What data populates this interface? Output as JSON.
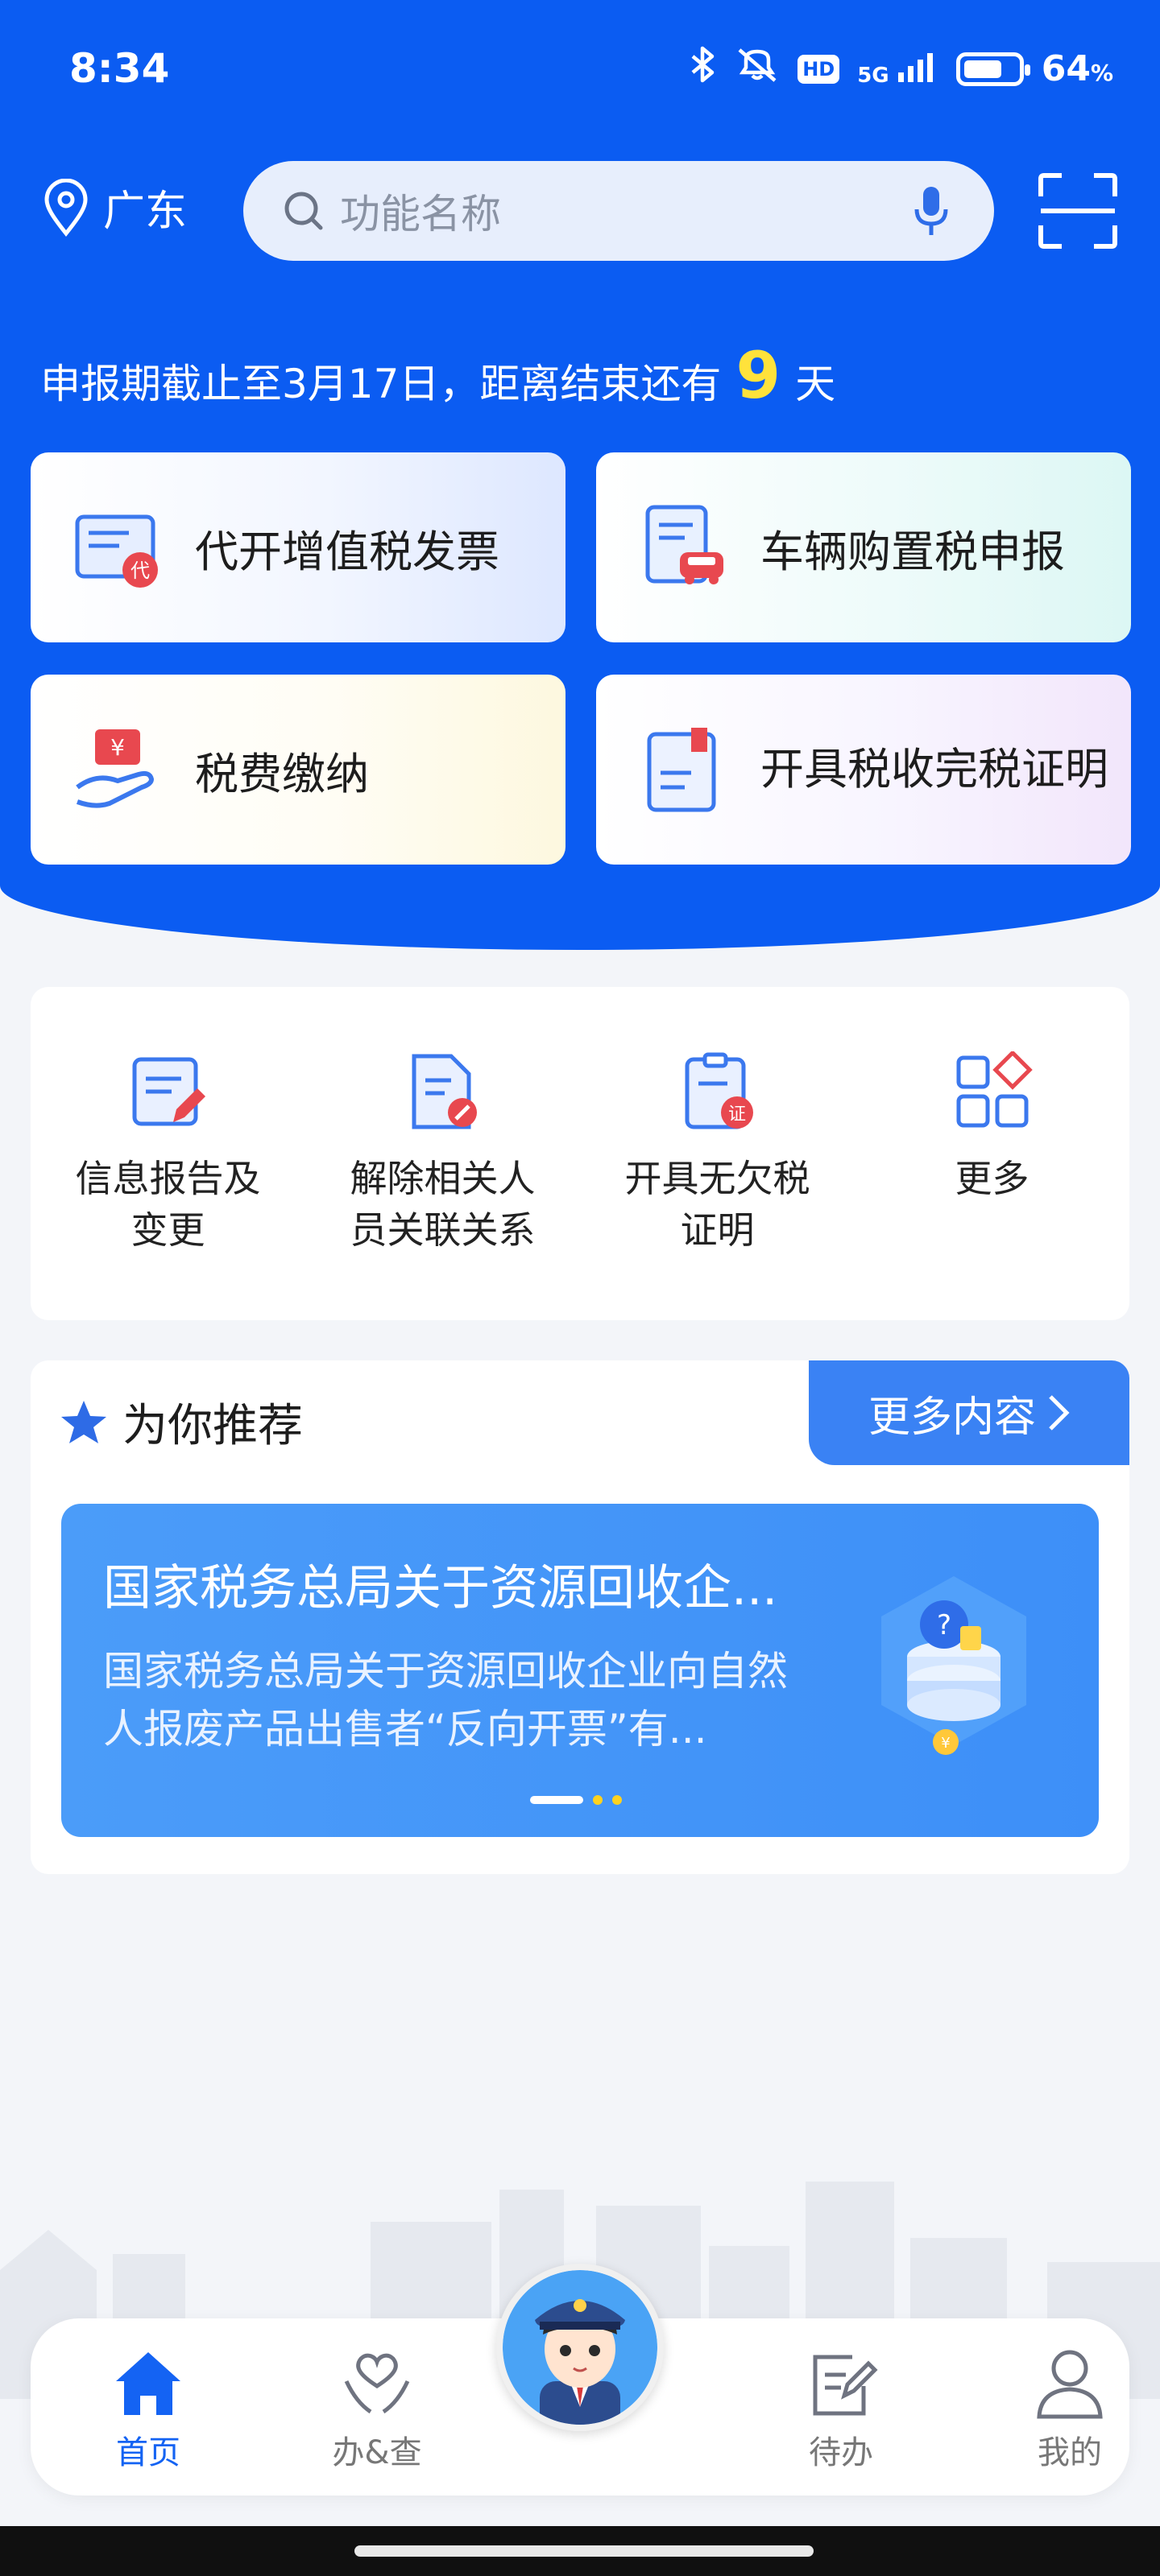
{
  "status_bar": {
    "time": "8:34",
    "battery": "64",
    "battery_unit": "%",
    "network": "5G",
    "hd": "HD"
  },
  "header": {
    "location": "广东",
    "search_placeholder": "功能名称"
  },
  "deadline": {
    "prefix": "申报期截止至3月17日，距离结束还有",
    "days": "9",
    "suffix": "天"
  },
  "quick_actions": [
    {
      "label": "代开增值税发票",
      "icon": "invoice-icon"
    },
    {
      "label": "车辆购置税申报",
      "icon": "vehicle-tax-icon"
    },
    {
      "label": "税费缴纳",
      "icon": "payment-hand-icon"
    },
    {
      "label": "开具税收完税证明",
      "icon": "tax-certificate-icon"
    }
  ],
  "services": [
    {
      "label": "信息报告及变更",
      "icon": "report-edit-icon"
    },
    {
      "label": "解除相关人员关联关系",
      "icon": "unlink-document-icon"
    },
    {
      "label": "开具无欠税证明",
      "icon": "no-arrears-certificate-icon"
    },
    {
      "label": "更多",
      "icon": "more-grid-icon"
    }
  ],
  "recommend": {
    "title": "为你推荐",
    "more_label": "更多内容",
    "banner_title": "国家税务总局关于资源回收企...",
    "banner_desc": "国家税务总局关于资源回收企业向自然人报废产品出售者“反向开票”有..."
  },
  "tabs": [
    {
      "label": "首页",
      "icon": "home-icon",
      "active": true
    },
    {
      "label": "办&查",
      "icon": "heart-hands-icon",
      "active": false
    },
    {
      "label": "待办",
      "icon": "todo-edit-icon",
      "active": false
    },
    {
      "label": "我的",
      "icon": "user-icon",
      "active": false
    }
  ],
  "colors": {
    "primary": "#0b5cf2",
    "accent_yellow": "#ffe23b",
    "tab_active": "#1463f3"
  }
}
